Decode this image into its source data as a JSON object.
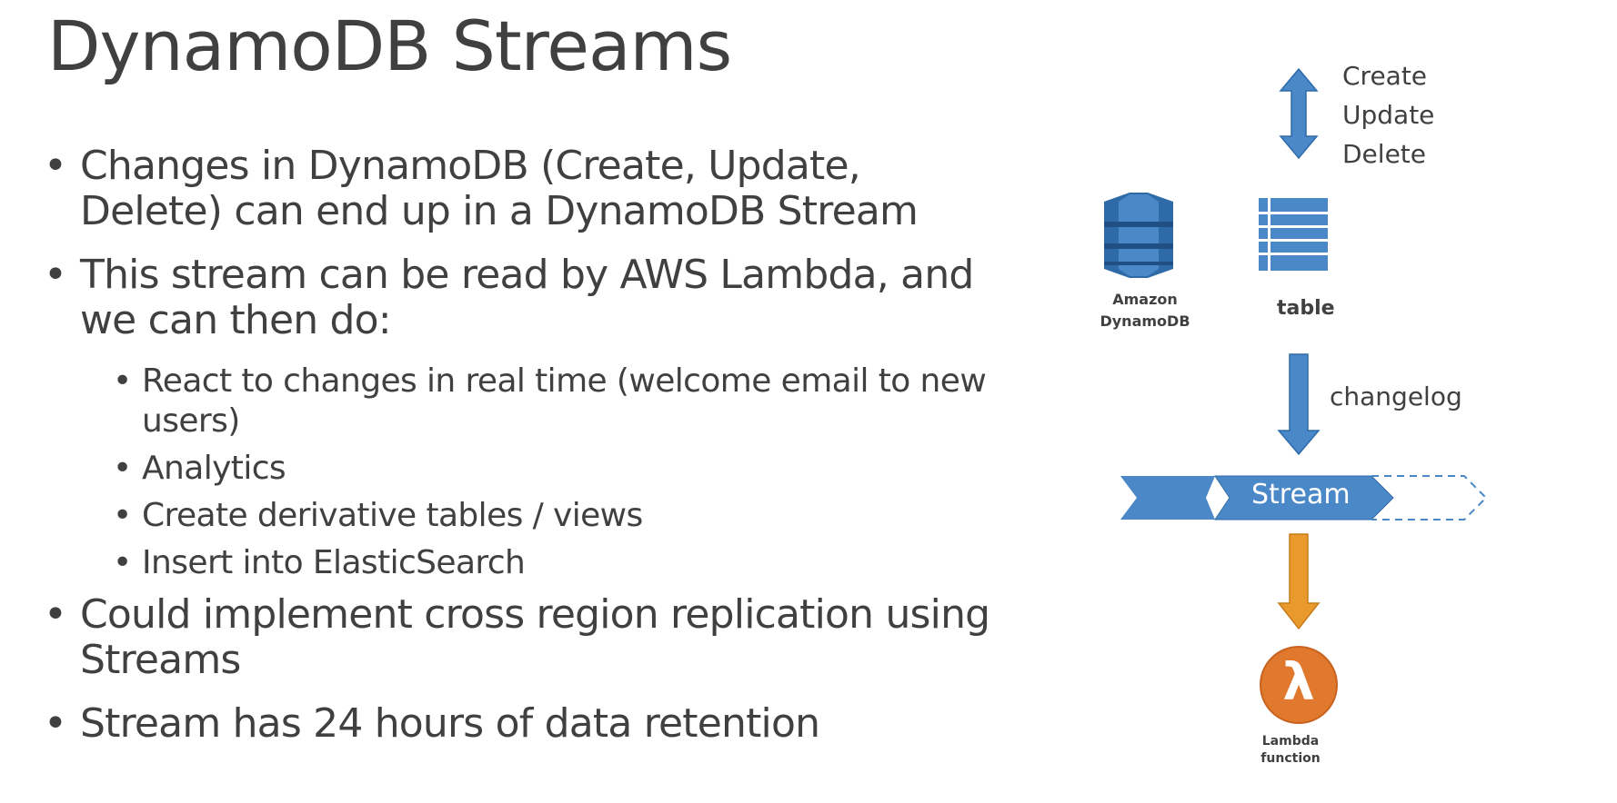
{
  "slide": {
    "title": "DynamoDB Streams",
    "bullets": [
      {
        "text": "Changes in DynamoDB (Create, Update, Delete) can end up in a DynamoDB Stream"
      },
      {
        "text": "This stream can be read by AWS Lambda, and we can then do:",
        "sub": [
          "React to changes in real time (welcome email to new users)",
          "Analytics",
          "Create derivative tables / views",
          "Insert into ElasticSearch"
        ]
      },
      {
        "text": "Could implement cross region replication using Streams"
      },
      {
        "text": "Stream has 24 hours of data retention"
      }
    ],
    "bullet_glyph": "•"
  },
  "diagram": {
    "operations": [
      "Create",
      "Update",
      "Delete"
    ],
    "dynamodb_label": "Amazon DynamoDB",
    "table_label": "table",
    "changelog_label": "changelog",
    "stream_label": "Stream",
    "lambda_label": "Lambda function",
    "lambda_glyph": "λ",
    "colors": {
      "blue": "#4a88c8",
      "blue_dark": "#2f6aa8",
      "orange": "#e89a2c",
      "lambda_orange": "#e0782d",
      "text": "#404040"
    },
    "icons": [
      "dynamodb-icon",
      "table-icon",
      "lambda-icon",
      "stream-shape"
    ]
  }
}
